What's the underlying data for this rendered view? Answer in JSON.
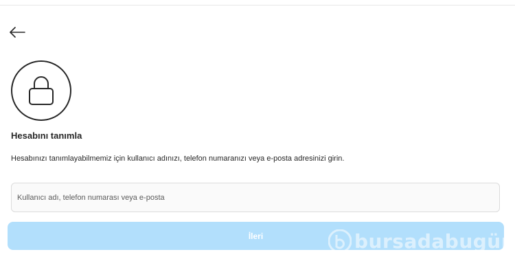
{
  "header": {
    "back_icon": "arrow-left-icon"
  },
  "lock": {
    "icon": "lock-icon"
  },
  "main": {
    "title": "Hesabını tanımla",
    "description": "Hesabınızı tanımlayabilmemiz için kullanıcı adınızı, telefon numaranızı veya e-posta adresinizi girin.",
    "input_placeholder": "Kullanıcı adı, telefon numarası veya e-posta",
    "input_value": "",
    "next_label": "İleri"
  },
  "watermark": {
    "text": "bursadabugün"
  },
  "colors": {
    "button_disabled": "#b2dffc",
    "text": "#262626",
    "input_border": "#dbdbdb",
    "input_bg": "#fafafa"
  }
}
